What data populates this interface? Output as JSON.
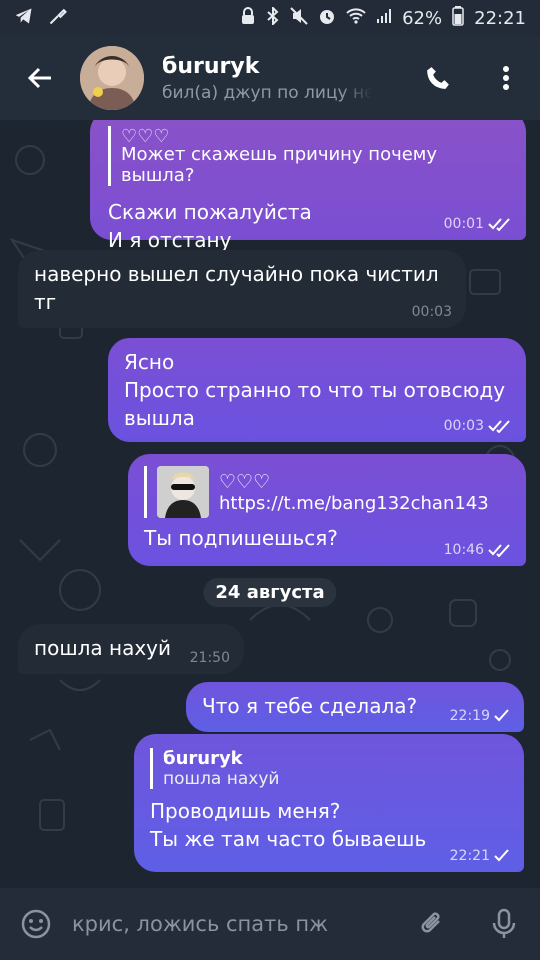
{
  "status_bar": {
    "battery_percent": "62%",
    "time": "22:21"
  },
  "header": {
    "contact_name": "бururyk",
    "status_text": "бил(а) джуп по лицу неделю назад"
  },
  "messages": [
    {
      "direction": "out",
      "reply_text": "♡♡♡",
      "reply_sub": "Может скажешь причину почему вышла?",
      "text_line1": "Скажи пожалуйста",
      "text_line2": "И я отстану",
      "time": "00:01"
    },
    {
      "direction": "in",
      "text_line1": "наверно вышел случайно пока чистил",
      "text_line2": "тг",
      "time": "00:03"
    },
    {
      "direction": "out",
      "text_line1": "Ясно",
      "text_line2": "Просто странно то что ты отовсюду",
      "text_line3": "вышла",
      "time": "00:03"
    },
    {
      "direction": "out",
      "link_title": "♡♡♡",
      "link_url": "https://t.me/bang132chan143",
      "text_line1": "Ты подпишешься?",
      "time": "10:46"
    },
    {
      "direction": "in",
      "text_line1": "пошла нахуй",
      "time": "21:50"
    },
    {
      "direction": "out",
      "text_line1": "Что я тебе сделала?",
      "time": "22:19"
    },
    {
      "direction": "out",
      "reply_name": "бururyk",
      "reply_sub": "пошла нахуй",
      "text_line1": "Проводишь меня?",
      "text_line2": "Ты же там часто бываешь",
      "time": "22:21"
    }
  ],
  "date_chip": "24 августа",
  "input": {
    "placeholder": "крис, ложись спать пж"
  },
  "colors": {
    "accent_out": "#7a4ed3",
    "incoming": "#232b36",
    "background": "#1d2630"
  }
}
